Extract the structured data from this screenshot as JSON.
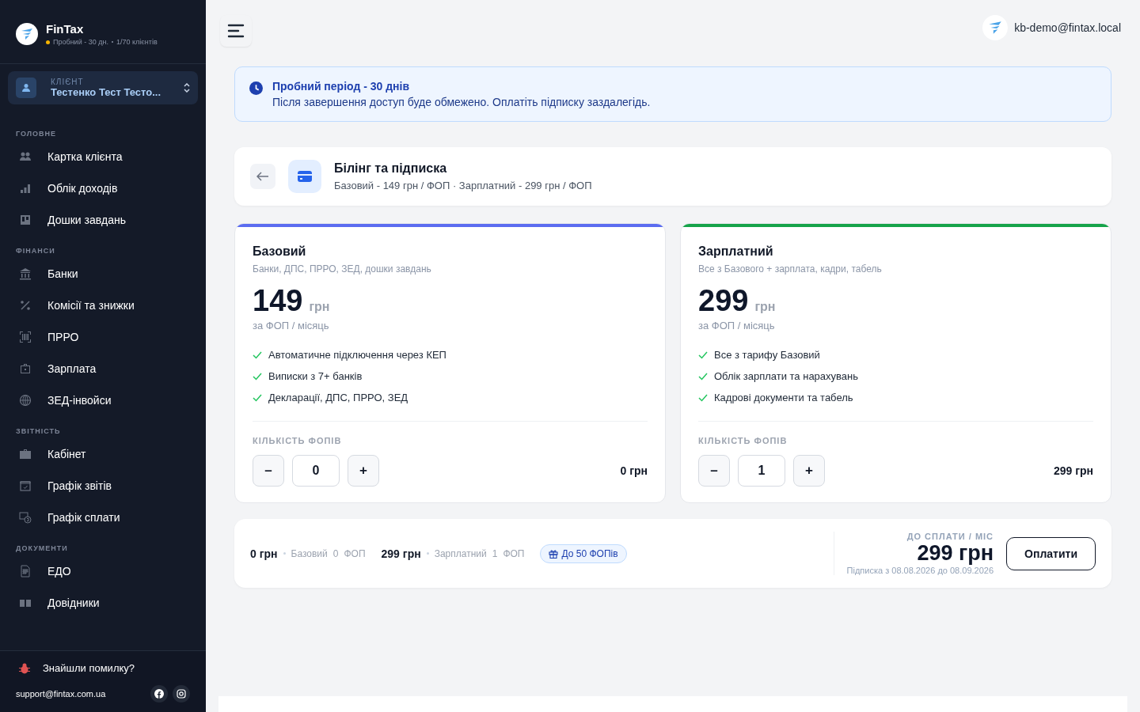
{
  "brand": {
    "name": "FinTax",
    "plan": "Пробний - 30 дн.",
    "clients": "1/70 клієнтів"
  },
  "client": {
    "label": "КЛІЄНТ",
    "name": "Тестенко Тест Тесто..."
  },
  "nav": [
    {
      "title": "ГОЛОВНЕ",
      "items": [
        {
          "label": "Картка клієнта"
        },
        {
          "label": "Облік доходів"
        },
        {
          "label": "Дошки завдань"
        }
      ]
    },
    {
      "title": "ФІНАНСИ",
      "items": [
        {
          "label": "Банки"
        },
        {
          "label": "Комісії та знижки"
        },
        {
          "label": "ПРРО"
        },
        {
          "label": "Зарплата"
        },
        {
          "label": "ЗЕД-інвойси"
        }
      ]
    },
    {
      "title": "ЗВІТНІСТЬ",
      "items": [
        {
          "label": "Кабінет"
        },
        {
          "label": "Графік звітів"
        },
        {
          "label": "Графік сплати"
        }
      ]
    },
    {
      "title": "ДОКУМЕНТИ",
      "items": [
        {
          "label": "ЕДО"
        },
        {
          "label": "Довідники"
        }
      ]
    }
  ],
  "footer": {
    "bug": "Знайшли помилку?",
    "email": "support@fintax.com.ua"
  },
  "user": "kb-demo@fintax.local",
  "banner": {
    "title": "Пробний період - 30 днів",
    "text": "Після завершення доступ буде обмежено. Оплатіть підписку заздалегідь."
  },
  "page": {
    "title": "Білінг та підписка",
    "subtitle": "Базовий - 149 грн / ФОП · Зарплатний - 299 грн / ФОП"
  },
  "plans": [
    {
      "name": "Базовий",
      "desc": "Банки, ДПС, ПРРО, ЗЕД, дошки завдань",
      "price": "149",
      "unit": "грн",
      "per": "за ФОП / місяць",
      "color": "#5b6cf0",
      "features": [
        "Автоматичне підключення через КЕП",
        "Виписки з 7+ банків",
        "Декларації, ДПС, ПРРО, ЗЕД"
      ],
      "qty_label": "КІЛЬКІСТЬ ФОПІВ",
      "minus": "–",
      "qty": "0",
      "plus": "+",
      "total": "0 грн"
    },
    {
      "name": "Зарплатний",
      "desc": "Все з Базового + зарплата, кадри, табель",
      "price": "299",
      "unit": "грн",
      "per": "за ФОП / місяць",
      "color": "#16a34a",
      "features": [
        "Все з тарифу Базовий",
        "Облік зарплати та нарахувань",
        "Кадрові документи та табель"
      ],
      "qty_label": "КІЛЬКІСТЬ ФОПІВ",
      "minus": "–",
      "qty": "1",
      "plus": "+",
      "total": "299 грн"
    }
  ],
  "summary": {
    "items": [
      {
        "amount": "0 грн",
        "plan": "Базовий",
        "count": "0",
        "unit": "ФОП"
      },
      {
        "amount": "299 грн",
        "plan": "Зарплатний",
        "count": "1",
        "unit": "ФОП"
      }
    ],
    "badge": "До 50 ФОПів",
    "due_label": "ДО СПЛАТИ / МІС",
    "due": "299 грн",
    "period": "Підписка з 08.08.2026 до 08.09.2026",
    "pay": "Оплатити"
  }
}
